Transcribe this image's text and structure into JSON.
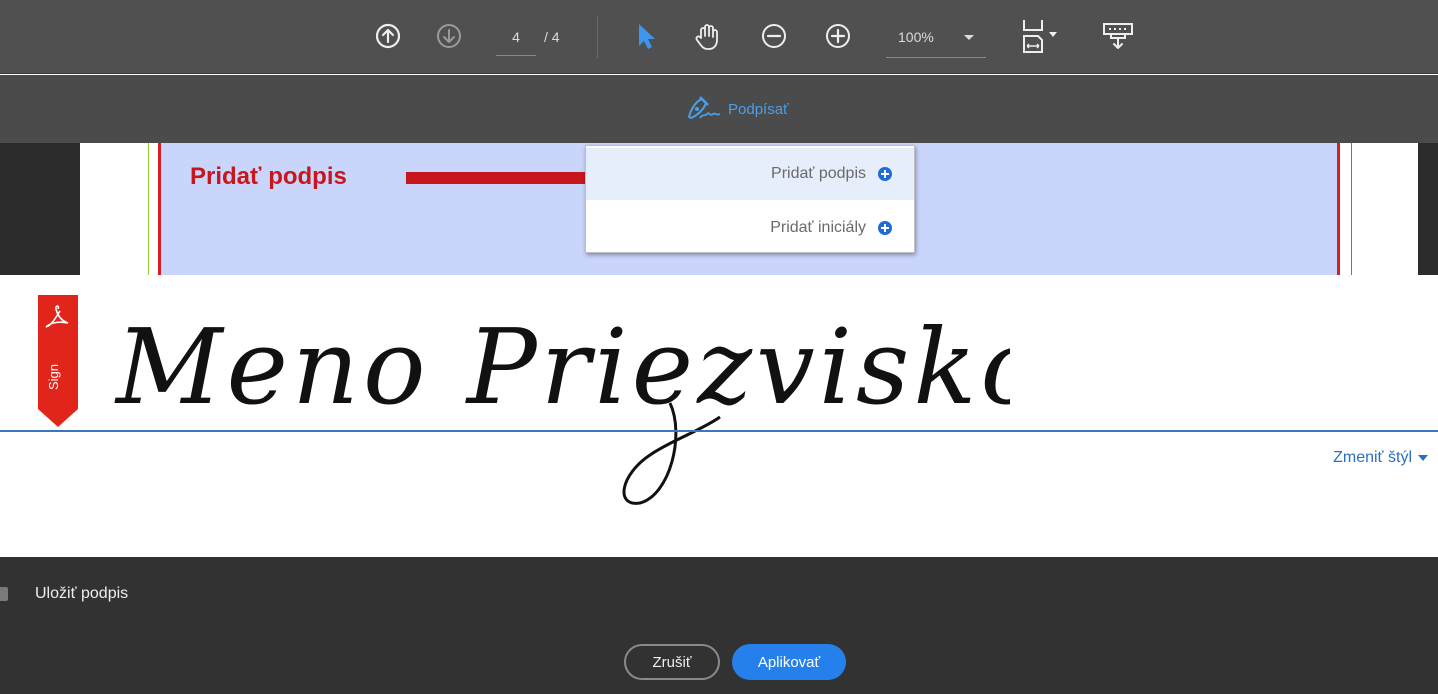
{
  "toolbar": {
    "prev_page_icon": "arrow-up-circle-icon",
    "next_page_icon": "arrow-down-circle-icon",
    "current_page": "4",
    "total_pages": "/ 4",
    "select_tool_icon": "pointer-icon",
    "hand_tool_icon": "hand-icon",
    "zoom_out_icon": "minus-circle-icon",
    "zoom_in_icon": "plus-circle-icon",
    "zoom_level": "100%",
    "fit_page_icon": "fit-page-icon",
    "scroll_mode_icon": "scroll-mode-icon"
  },
  "signbar": {
    "label": "Podpísať",
    "icon": "sign-pen-icon"
  },
  "annotation": {
    "text": "Pridať podpis"
  },
  "menu": {
    "items": [
      {
        "label": "Pridať podpis",
        "icon": "plus-circle-icon"
      },
      {
        "label": "Pridať iniciály",
        "icon": "plus-circle-icon"
      }
    ]
  },
  "signature_panel": {
    "ribbon_text": "Sign",
    "signature": "Meno Priezvisko",
    "change_style": "Zmeniť štýl"
  },
  "footer": {
    "save_label": "Uložiť podpis",
    "cancel": "Zrušiť",
    "apply": "Aplikovať"
  },
  "colors": {
    "accent": "#2680eb",
    "annotation_red": "#c8161d",
    "field_blue": "#cad5fc",
    "toolbar": "#505050",
    "bottombar": "#323232"
  }
}
